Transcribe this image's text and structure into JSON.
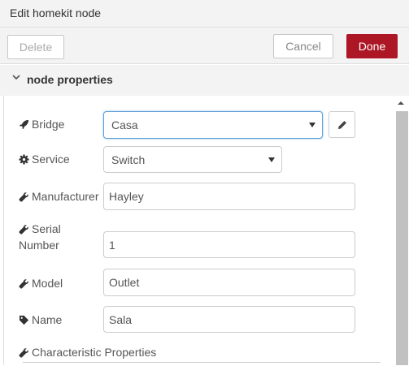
{
  "header": {
    "title": "Edit homekit node"
  },
  "toolbar": {
    "delete_label": "Delete",
    "cancel_label": "Cancel",
    "done_label": "Done"
  },
  "section": {
    "title": "node properties"
  },
  "fields": {
    "bridge": {
      "label": "Bridge",
      "value": "Casa"
    },
    "service": {
      "label": "Service",
      "value": "Switch"
    },
    "manufacturer": {
      "label": "Manufacturer",
      "value": "Hayley"
    },
    "serial": {
      "label_line1": "Serial",
      "label_line2": "Number",
      "value": "1"
    },
    "model": {
      "label": "Model",
      "value": "Outlet"
    },
    "name": {
      "label": "Name",
      "value": "Sala"
    },
    "characteristics": {
      "label": "Characteristic Properties"
    }
  },
  "colors": {
    "done": "#ad1625",
    "focus": "#5fa0d8"
  },
  "icons": {
    "bridge": "rocket-icon",
    "service": "gear-icon",
    "manufacturer": "wrench-icon",
    "name": "tag-icon",
    "edit": "pencil-icon"
  }
}
